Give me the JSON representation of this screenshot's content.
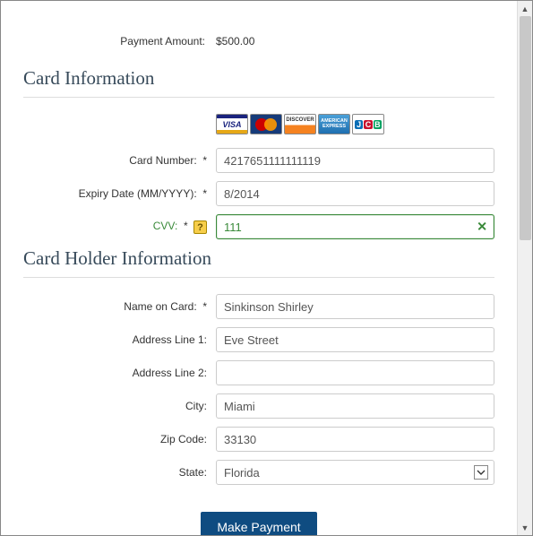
{
  "payment": {
    "amount_label": "Payment Amount:",
    "amount_value": "$500.00"
  },
  "sections": {
    "card_info": "Card Information",
    "holder_info": "Card Holder Information"
  },
  "labels": {
    "card_number": "Card Number:",
    "expiry": "Expiry Date (MM/YYYY):",
    "cvv": "CVV:",
    "name": "Name on Card:",
    "addr1": "Address Line 1:",
    "addr2": "Address Line 2:",
    "city": "City:",
    "zip": "Zip Code:",
    "state": "State:",
    "required": "*",
    "help": "?"
  },
  "values": {
    "card_number": "4217651111111119",
    "expiry": "8/2014",
    "cvv": "111",
    "name": "Sinkinson Shirley",
    "addr1": "Eve Street",
    "addr2": "",
    "city": "Miami",
    "zip": "33130",
    "state": "Florida"
  },
  "card_brands": {
    "visa": "VISA",
    "mastercard": "MasterCard",
    "discover": "DISCOVER",
    "amex_l1": "AMERICAN",
    "amex_l2": "EXPRESS",
    "jcb_j": "J",
    "jcb_c": "C",
    "jcb_b": "B"
  },
  "buttons": {
    "submit": "Make Payment"
  },
  "icons": {
    "clear": "✕",
    "chevron_down": "⌄",
    "scroll_up": "▲",
    "scroll_down": "▼"
  }
}
